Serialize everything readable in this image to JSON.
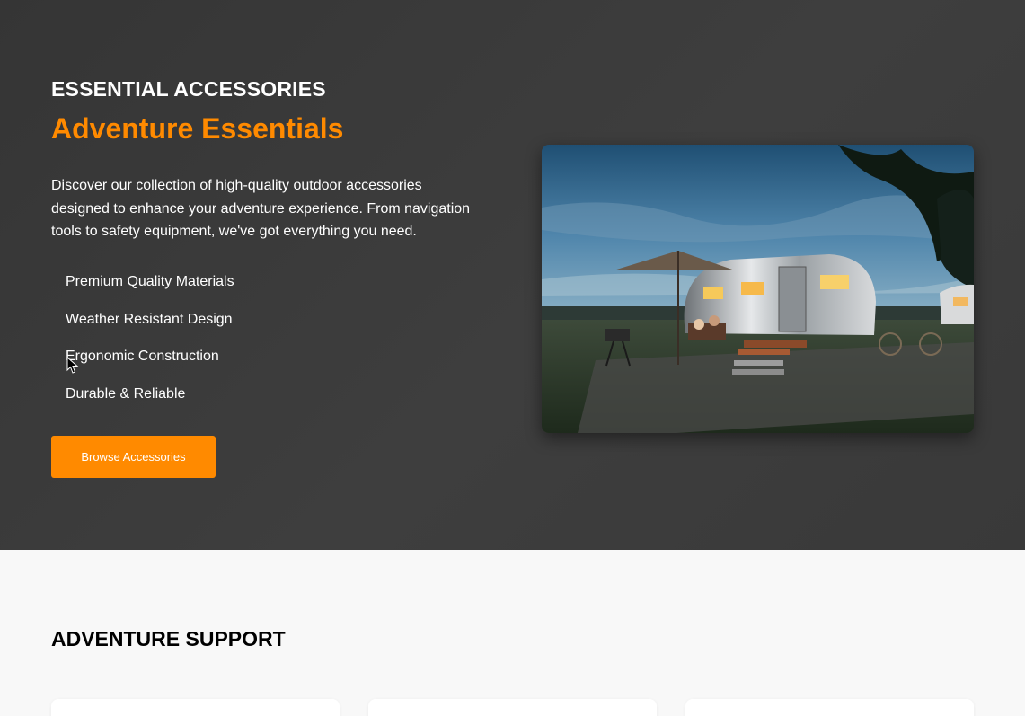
{
  "hero": {
    "eyebrow": "ESSENTIAL ACCESSORIES",
    "headline": "Adventure Essentials",
    "description": "Discover our collection of high-quality outdoor accessories designed to enhance your adventure experience. From navigation tools to safety equipment, we've got everything you need.",
    "features": [
      "Premium Quality Materials",
      "Weather Resistant Design",
      "Ergonomic Construction",
      "Durable & Reliable"
    ],
    "cta_label": "Browse Accessories",
    "image_subject": "vintage-airstream-trailer-camp-photo"
  },
  "support": {
    "title": "ADVENTURE SUPPORT"
  },
  "colors": {
    "accent": "#ff8a00",
    "hero_bg": "#3a3a3a",
    "section_bg": "#f8f8f8"
  }
}
